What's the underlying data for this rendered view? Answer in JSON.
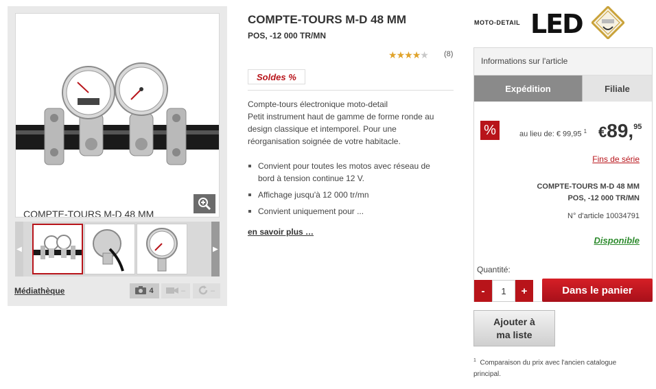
{
  "gallery": {
    "caption": "COMPTE-TOURS M-D 48 MM",
    "media_label": "Médiathèque",
    "photo_count": "4",
    "video_count": "–",
    "rotate_count": "–"
  },
  "product": {
    "title": "COMPTE-TOURS M-D 48 MM",
    "subtitle": "POS, -12 000 TR/MN",
    "rating": 4,
    "rating_max": 5,
    "review_count": "(8)",
    "sale_badge": "Soldes %",
    "description": [
      "Compte-tours électronique moto-detail",
      "Petit instrument haut de gamme de forme ronde au design classique et intemporel. Pour une réorganisation soignée de votre habitacle."
    ],
    "bullets": [
      "Convient pour toutes les motos avec réseau de bord à tension continue 12 V.",
      "Affichage jusqu'à 12 000 tr/mn",
      "Convient uniquement pour ..."
    ],
    "more_link": "en savoir plus …"
  },
  "logos": {
    "brand": "MOTO-DETAIL",
    "led": "LED"
  },
  "panel": {
    "header": "Informations sur l'article",
    "tabs": [
      "Expédition",
      "Filiale"
    ],
    "percent_icon": "%",
    "old_price": "au lieu de: € 99,95",
    "old_price_note": "1",
    "currency": "€",
    "price_main": "89,",
    "price_cents": "95",
    "series_link": "Fins de série",
    "name_line1": "COMPTE-TOURS M-D 48 MM",
    "name_line2": "POS, -12 000 TR/MN",
    "ref": "N° d'article 10034791",
    "stock": "Disponible",
    "qty_label": "Quantité:",
    "qty_minus": "-",
    "qty_value": "1",
    "qty_plus": "+",
    "cart_button": "Dans le panier"
  },
  "wishlist": {
    "line1": "Ajouter à",
    "line2": "ma liste"
  },
  "footnote": {
    "marker": "1",
    "text": "Comparaison du prix avec l'ancien catalogue principal."
  },
  "colors": {
    "accent": "#b8141a",
    "stock": "#2e8b2e",
    "tab_active": "#8a8a8a"
  }
}
